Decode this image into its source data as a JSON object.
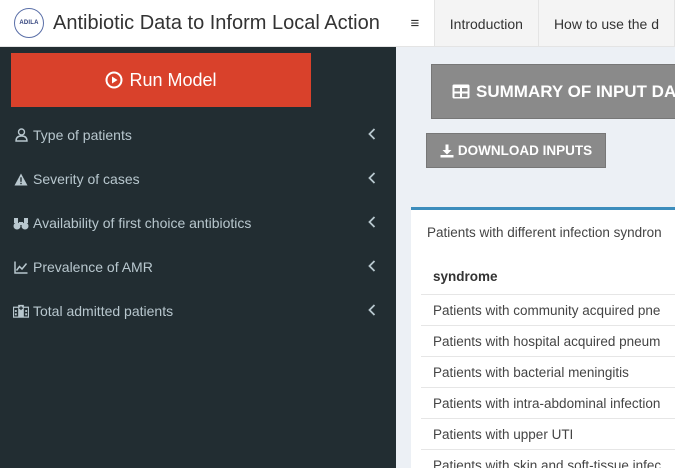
{
  "header": {
    "logo_text": "ADILA",
    "app_title": "Antibiotic Data to Inform Local Action",
    "menu_toggle_glyph": "≡",
    "tabs": [
      {
        "label": "Introduction"
      },
      {
        "label": "How to use the d"
      }
    ]
  },
  "sidebar": {
    "run_button": "Run Model",
    "items": [
      {
        "label": "Type of patients",
        "icon": "user-icon"
      },
      {
        "label": "Severity of cases",
        "icon": "warning-icon"
      },
      {
        "label": "Availability of first choice antibiotics",
        "icon": "binoculars-icon"
      },
      {
        "label": "Prevalence of AMR",
        "icon": "line-chart-icon"
      },
      {
        "label": "Total admitted patients",
        "icon": "hospital-icon"
      }
    ]
  },
  "main": {
    "summary_button": "SUMMARY OF INPUT DAT",
    "download_button": "DOWNLOAD INPUTS",
    "table_caption": "Patients with different infection syndron",
    "table_header": "syndrome",
    "rows": [
      "Patients with community acquired pne",
      "Patients with hospital acquired pneum",
      "Patients with bacterial meningitis",
      "Patients with intra-abdominal infection",
      "Patients with upper UTI",
      "Patients with skin and soft-tissue infec"
    ]
  },
  "colors": {
    "sidebar_bg": "#222d32",
    "run_button": "#d9412b",
    "grey_button": "#8a8a8a",
    "box_accent": "#3c8dbc"
  }
}
